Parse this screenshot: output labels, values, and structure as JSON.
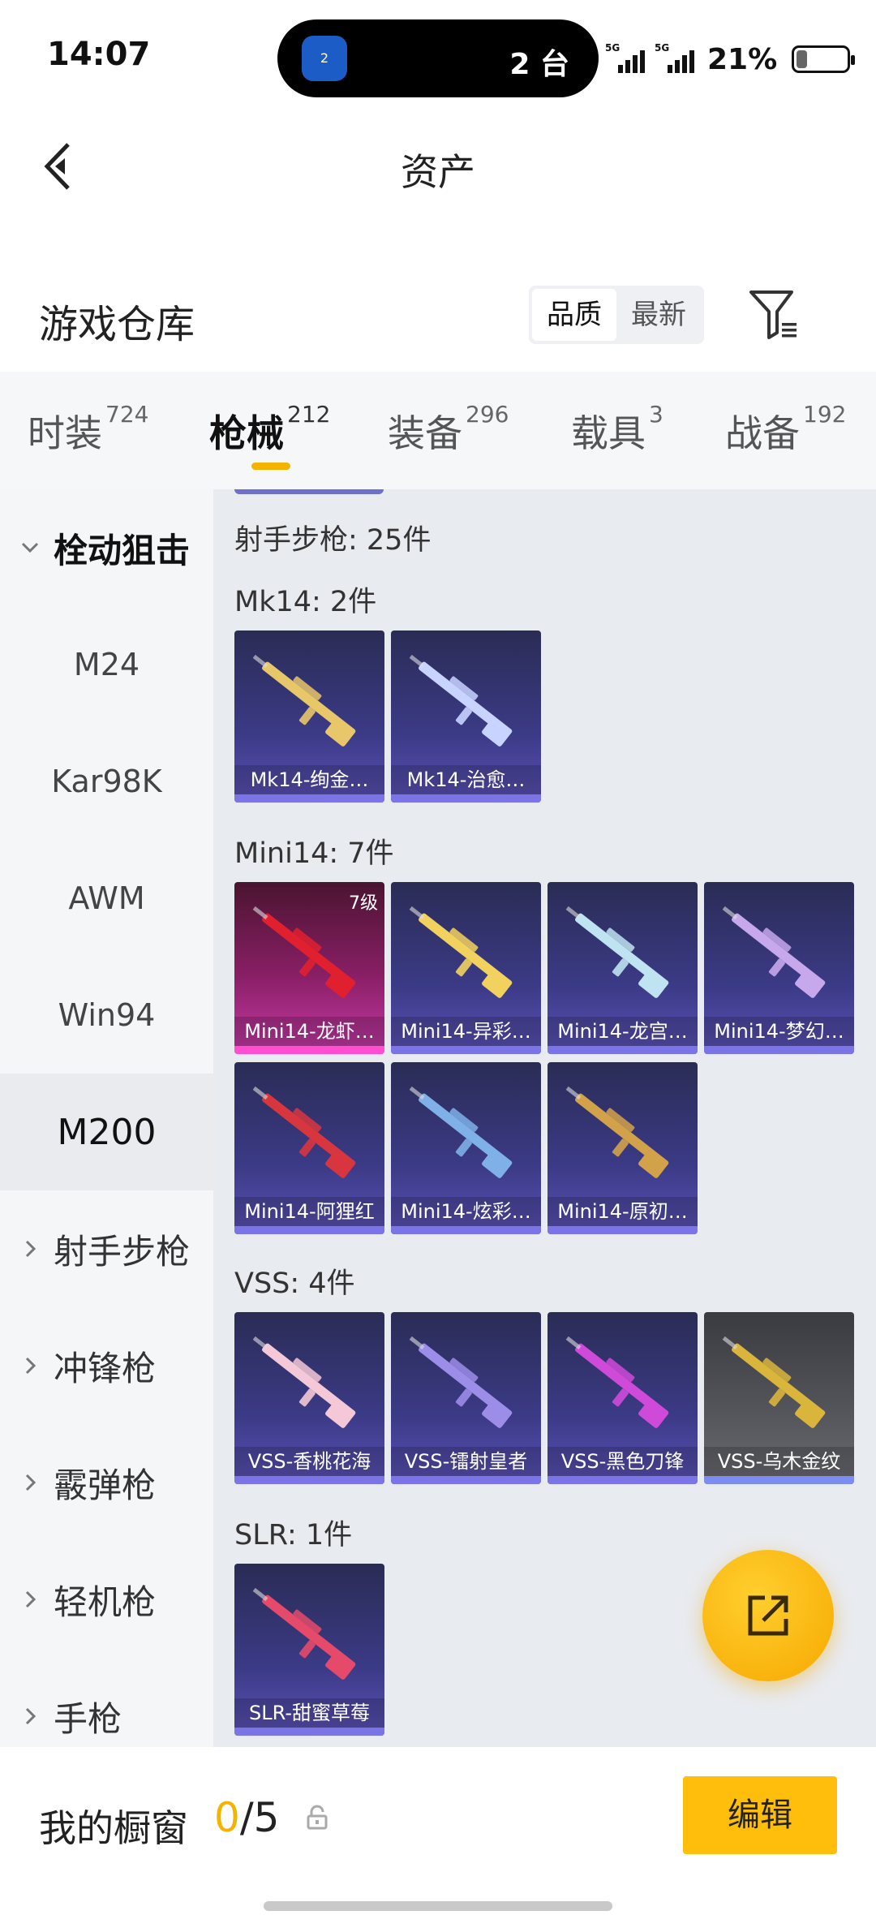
{
  "status_bar": {
    "time": "14:07",
    "island_app_label": "2",
    "island_count": "2 台",
    "network1": "5G",
    "network2": "5G",
    "battery": "21%"
  },
  "header": {
    "title": "资产"
  },
  "warehouse": {
    "title": "游戏仓库",
    "sort_options": [
      "品质",
      "最新"
    ],
    "sort_selected": "品质"
  },
  "tabs": [
    {
      "label": "时装",
      "count": "724"
    },
    {
      "label": "枪械",
      "count": "212",
      "active": true
    },
    {
      "label": "装备",
      "count": "296"
    },
    {
      "label": "载具",
      "count": "3"
    },
    {
      "label": "战备",
      "count": "192"
    }
  ],
  "sidebar": {
    "groups": [
      {
        "label": "栓动狙击",
        "expanded": true,
        "children": [
          "M24",
          "Kar98K",
          "AWM",
          "Win94",
          "M200"
        ],
        "selected": "M200"
      },
      {
        "label": "射手步枪"
      },
      {
        "label": "冲锋枪"
      },
      {
        "label": "霰弹枪"
      },
      {
        "label": "轻机枪"
      },
      {
        "label": "手枪"
      }
    ]
  },
  "content": {
    "summary": "射手步枪: 25件",
    "sections": [
      {
        "label": "Mk14: 2件",
        "items": [
          {
            "name": "Mk14-绚金…",
            "style": "purple",
            "accent": "#e8c66a"
          },
          {
            "name": "Mk14-治愈…",
            "style": "purple",
            "accent": "#c9d3ff"
          }
        ]
      },
      {
        "label": "Mini14: 7件",
        "items": [
          {
            "name": "Mini14-龙虾…",
            "style": "pink",
            "accent": "#e0202f",
            "badge": "7级"
          },
          {
            "name": "Mini14-异彩…",
            "style": "purple",
            "accent": "#f2d25e"
          },
          {
            "name": "Mini14-龙宫…",
            "style": "purple",
            "accent": "#bfe3f0"
          },
          {
            "name": "Mini14-梦幻…",
            "style": "purple",
            "accent": "#c7a8ec"
          },
          {
            "name": "Mini14-阿狸红",
            "style": "purple",
            "accent": "#d8363f"
          },
          {
            "name": "Mini14-炫彩…",
            "style": "purple",
            "accent": "#7fb0e8"
          },
          {
            "name": "Mini14-原初…",
            "style": "purple",
            "accent": "#d2a24a"
          }
        ]
      },
      {
        "label": "VSS: 4件",
        "items": [
          {
            "name": "VSS-香桃花海",
            "style": "purple",
            "accent": "#f4c8d6"
          },
          {
            "name": "VSS-镭射皇者",
            "style": "purple",
            "accent": "#9c8de8"
          },
          {
            "name": "VSS-黑色刀锋",
            "style": "purple",
            "accent": "#d04ad9"
          },
          {
            "name": "VSS-乌木金纹",
            "style": "grey",
            "accent": "#d9b53c"
          }
        ]
      },
      {
        "label": "SLR: 1件",
        "items": [
          {
            "name": "SLR-甜蜜草莓",
            "style": "purple",
            "accent": "#e54a6a"
          }
        ]
      }
    ]
  },
  "bottom": {
    "showcase_label": "我的橱窗",
    "showcase_used": "0",
    "showcase_total": "/5",
    "edit_label": "编辑"
  },
  "colors": {
    "accent": "#f5b301",
    "button": "#ffbe0b"
  }
}
